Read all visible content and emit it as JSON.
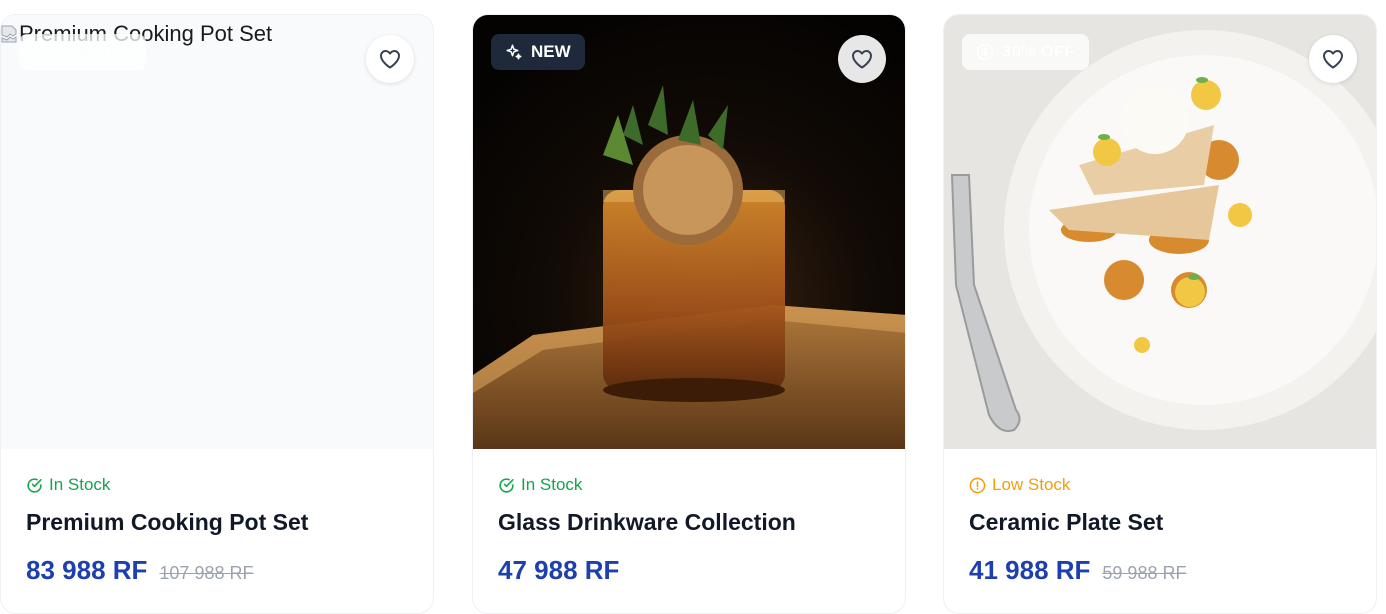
{
  "products": [
    {
      "image_alt": "Premium Cooking Pot Set",
      "badge": "22% OFF",
      "stock": "In Stock",
      "title": "Premium Cooking Pot Set",
      "price": "83 988 RF",
      "old_price": "107 988 RF"
    },
    {
      "badge": "NEW",
      "stock": "In Stock",
      "title": "Glass Drinkware Collection",
      "price": "47 988 RF"
    },
    {
      "badge": "30% OFF",
      "stock": "Low Stock",
      "title": "Ceramic Plate Set",
      "price": "41 988 RF",
      "old_price": "59 988 RF"
    }
  ],
  "colors": {
    "price": "#1e40af",
    "in_stock": "#16a34a",
    "low_stock": "#f59e0b",
    "new_badge_bg": "#1e293b"
  },
  "icons": {
    "discount": "dollar-circle-icon",
    "new": "sparkles-icon",
    "favorite": "heart-icon",
    "in_stock": "check-circle-icon",
    "low_stock": "alert-circle-icon"
  }
}
